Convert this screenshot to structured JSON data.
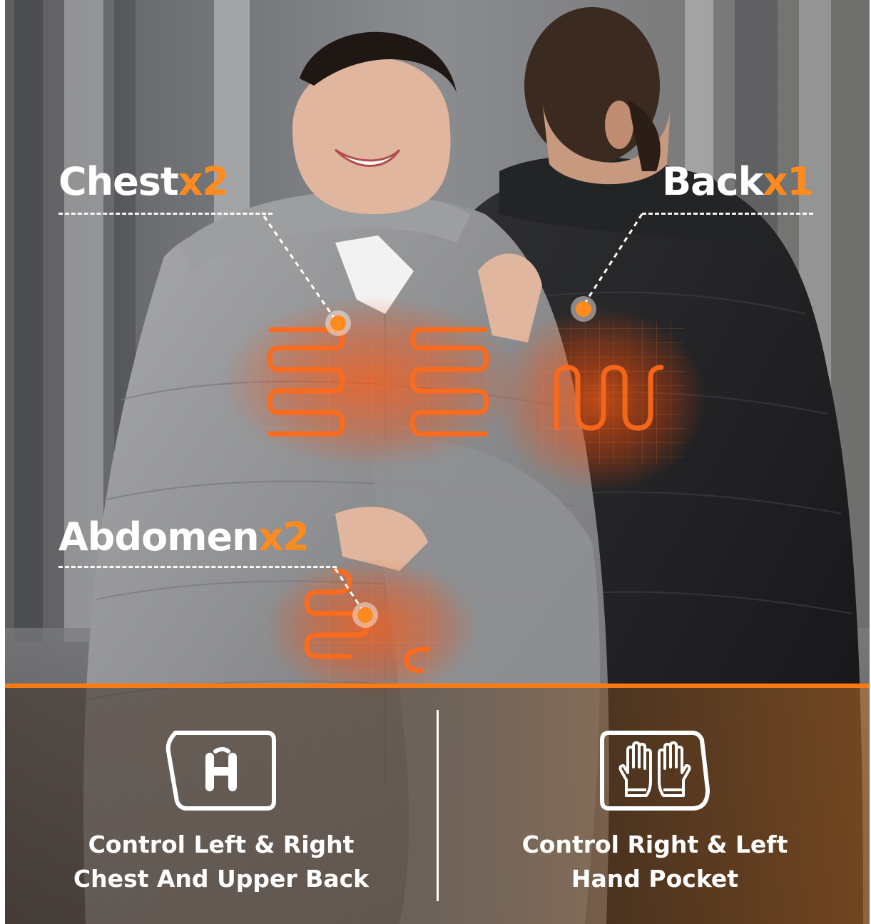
{
  "heating_zones": [
    {
      "name": "Chest",
      "count": "x2"
    },
    {
      "name": "Back",
      "count": "x1"
    },
    {
      "name": "Abdomen",
      "count": "x2"
    }
  ],
  "controls": [
    {
      "icon": "power-button-icon",
      "line1": "Control Left & Right",
      "line2": "Chest And Upper Back"
    },
    {
      "icon": "gloves-icon",
      "line1": "Control Right & Left",
      "line2": "Hand Pocket"
    }
  ],
  "colors": {
    "accent": "#ff7a12",
    "heat": "#ff5a10",
    "label": "#ffffff"
  }
}
